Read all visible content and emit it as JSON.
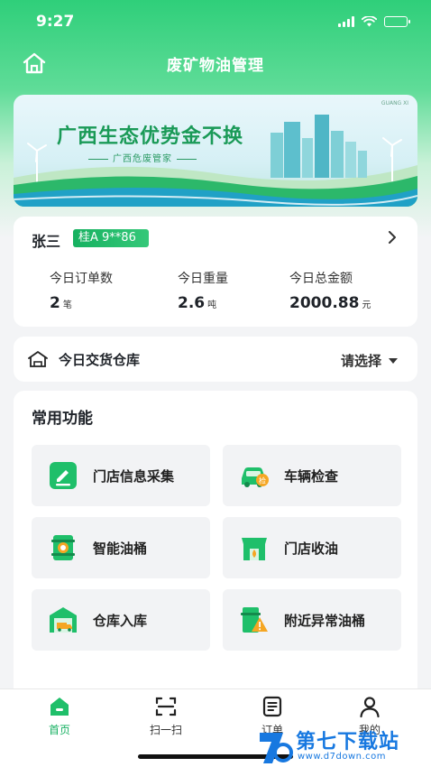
{
  "status_bar": {
    "time": "9:27"
  },
  "header": {
    "title": "废矿物油管理"
  },
  "banner": {
    "headline": "广西生态优势金不换",
    "subline": "广西危废管家",
    "region": "GUANG XI"
  },
  "user": {
    "name": "张三",
    "plate": "桂A 9**86",
    "stats": [
      {
        "label": "今日订单数",
        "value": "2",
        "unit": "笔"
      },
      {
        "label": "今日重量",
        "value": "2.6",
        "unit": "吨"
      },
      {
        "label": "今日总金额",
        "value": "2000.88",
        "unit": "元"
      }
    ]
  },
  "warehouse": {
    "label": "今日交货仓库",
    "select_placeholder": "请选择"
  },
  "functions": {
    "title": "常用功能",
    "items": [
      {
        "label": "门店信息采集",
        "icon": "edit-form-icon"
      },
      {
        "label": "车辆检查",
        "icon": "car-inspection-icon"
      },
      {
        "label": "智能油桶",
        "icon": "smart-barrel-icon"
      },
      {
        "label": "门店收油",
        "icon": "store-collect-icon"
      },
      {
        "label": "仓库入库",
        "icon": "warehouse-truck-icon"
      },
      {
        "label": "附近异常油桶",
        "icon": "abnormal-barrel-icon"
      }
    ]
  },
  "tabs": [
    {
      "label": "首页",
      "icon": "home-icon",
      "active": true
    },
    {
      "label": "扫一扫",
      "icon": "scan-icon",
      "active": false
    },
    {
      "label": "订单",
      "icon": "order-icon",
      "active": false
    },
    {
      "label": "我的",
      "icon": "user-icon",
      "active": false
    }
  ],
  "watermark": {
    "title": "第七下载站",
    "url": "www.d7down.com"
  },
  "colors": {
    "brand_green": "#1fbf6a",
    "text_dark": "#1f2329",
    "watermark_blue": "#1778e0"
  }
}
